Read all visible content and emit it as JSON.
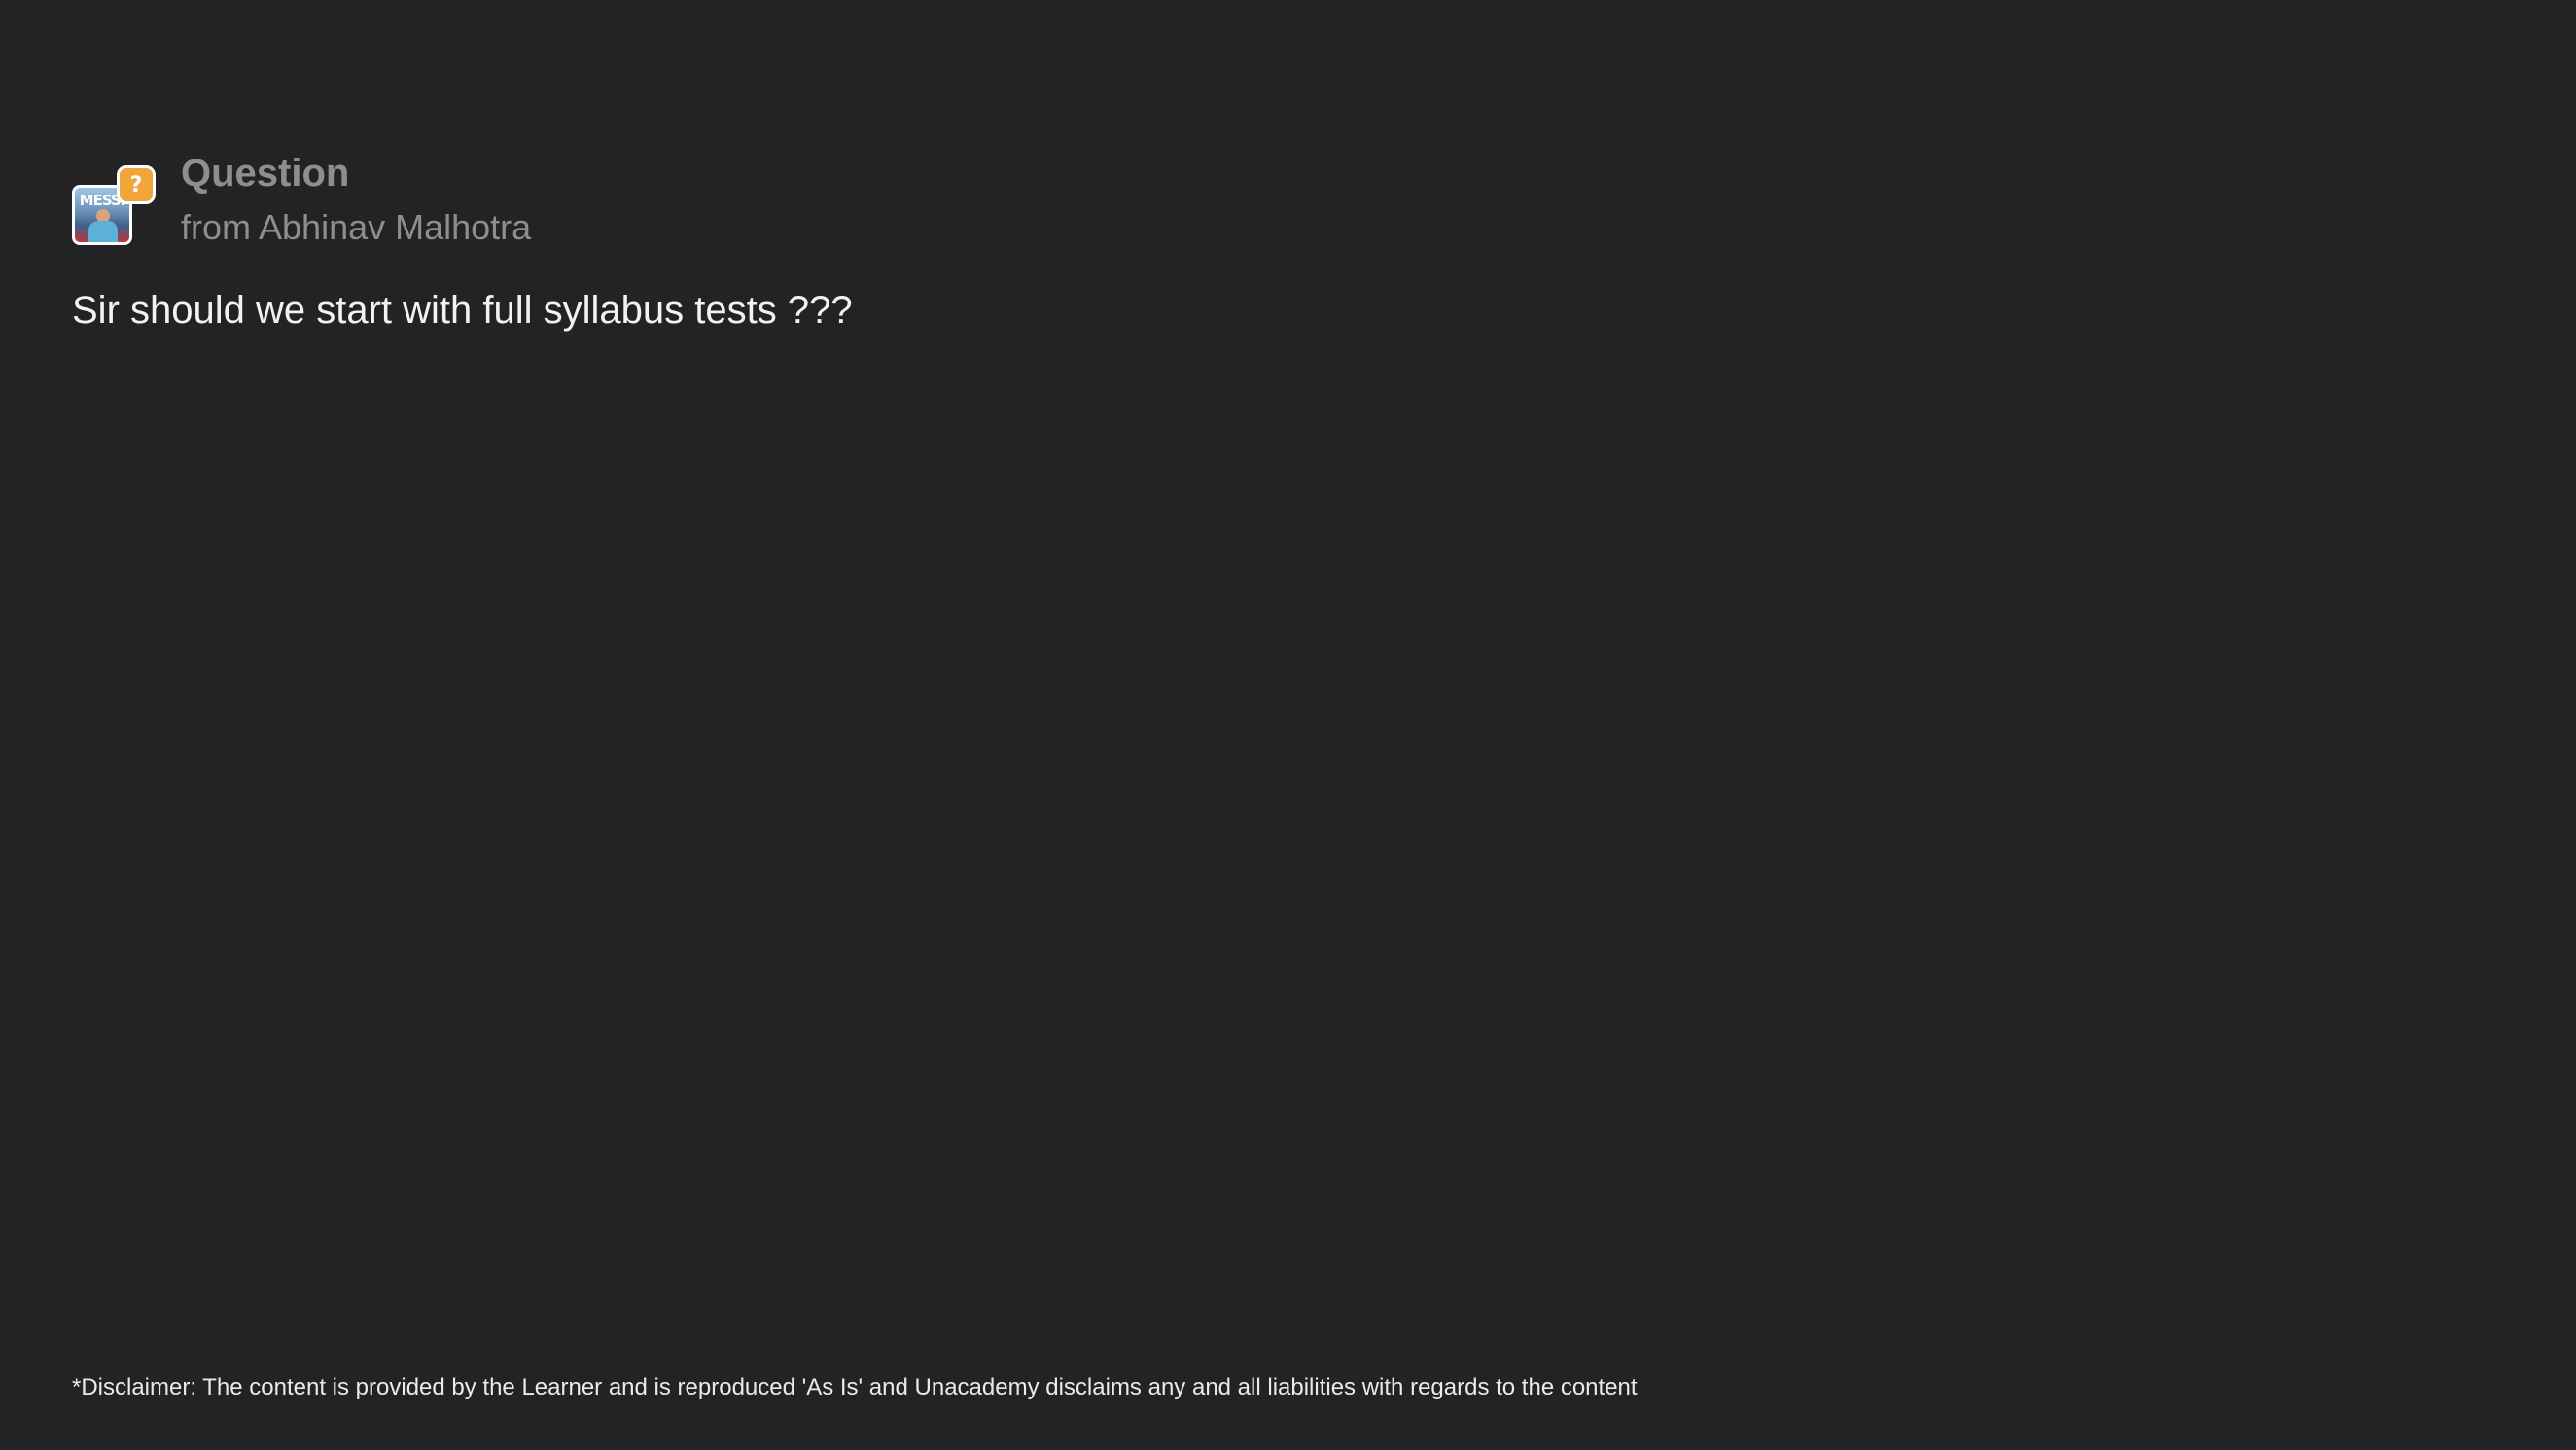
{
  "header": {
    "badge_icon": "question-mark-icon",
    "badge_glyph": "?",
    "badge_color": "#f2a53a",
    "avatar_text": "MESSI",
    "title": "Question",
    "subtitle": "from Abhinav Malhotra"
  },
  "question": {
    "text": "Sir should we start with full syllabus tests ???"
  },
  "footer": {
    "disclaimer": "*Disclaimer: The content is provided by the Learner and is reproduced 'As Is' and Unacademy disclaims any and all liabilities with regards to the content"
  },
  "colors": {
    "background": "#232325",
    "muted_text": "#8e8e90",
    "primary_text": "#f2f2f2"
  }
}
